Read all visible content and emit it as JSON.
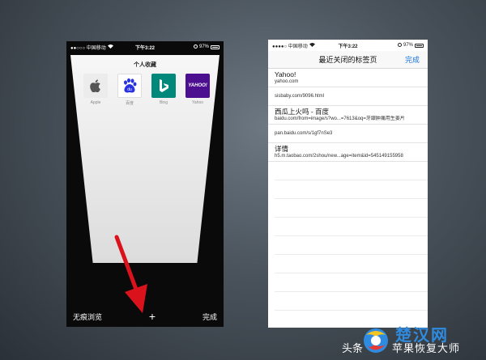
{
  "left_phone": {
    "status": {
      "carrier": "●●○○○ 中国移动",
      "time": "下午3:22",
      "battery": "97%"
    },
    "favorites_title": "个人收藏",
    "favorites": [
      {
        "label": "Apple",
        "icon": "apple-icon"
      },
      {
        "label": "百度",
        "icon": "baidu-icon"
      },
      {
        "label": "Bing",
        "icon": "bing-icon"
      },
      {
        "label": "Yahoo",
        "icon": "yahoo-icon",
        "glyph": "YAHOO!"
      }
    ],
    "toolbar": {
      "private_label": "无痕浏览",
      "add_label": "+",
      "done_label": "完成"
    }
  },
  "right_phone": {
    "status": {
      "carrier": "●●●●○ 中国移动",
      "time": "下午3:22",
      "battery": "97%"
    },
    "nav_title": "最近关闭的标签页",
    "done_label": "完成",
    "tabs": [
      {
        "title": "Yahoo!",
        "url": "yahoo.com"
      },
      {
        "title": "",
        "url": "sisbaby.com/9096.html"
      },
      {
        "title": "西瓜上火吗 - 百度",
        "url": "baidu.com/from=image/s?wo...=7613&oq=牙龈肿痛用生姜片"
      },
      {
        "title": "",
        "url": "pan.baidu.com/s/1gf7nSe3"
      },
      {
        "title": "详情",
        "url": "h5.m.taobao.com/2shou/new...age=item&id=545149155958"
      }
    ]
  },
  "watermark": {
    "brand": "楚汉网",
    "prefix": "头条",
    "subtitle": "苹果恢复大师"
  },
  "colors": {
    "accent": "#1a73d9",
    "arrow": "#d9121b",
    "bing": "#00897b",
    "yahoo": "#4b0f8f"
  }
}
